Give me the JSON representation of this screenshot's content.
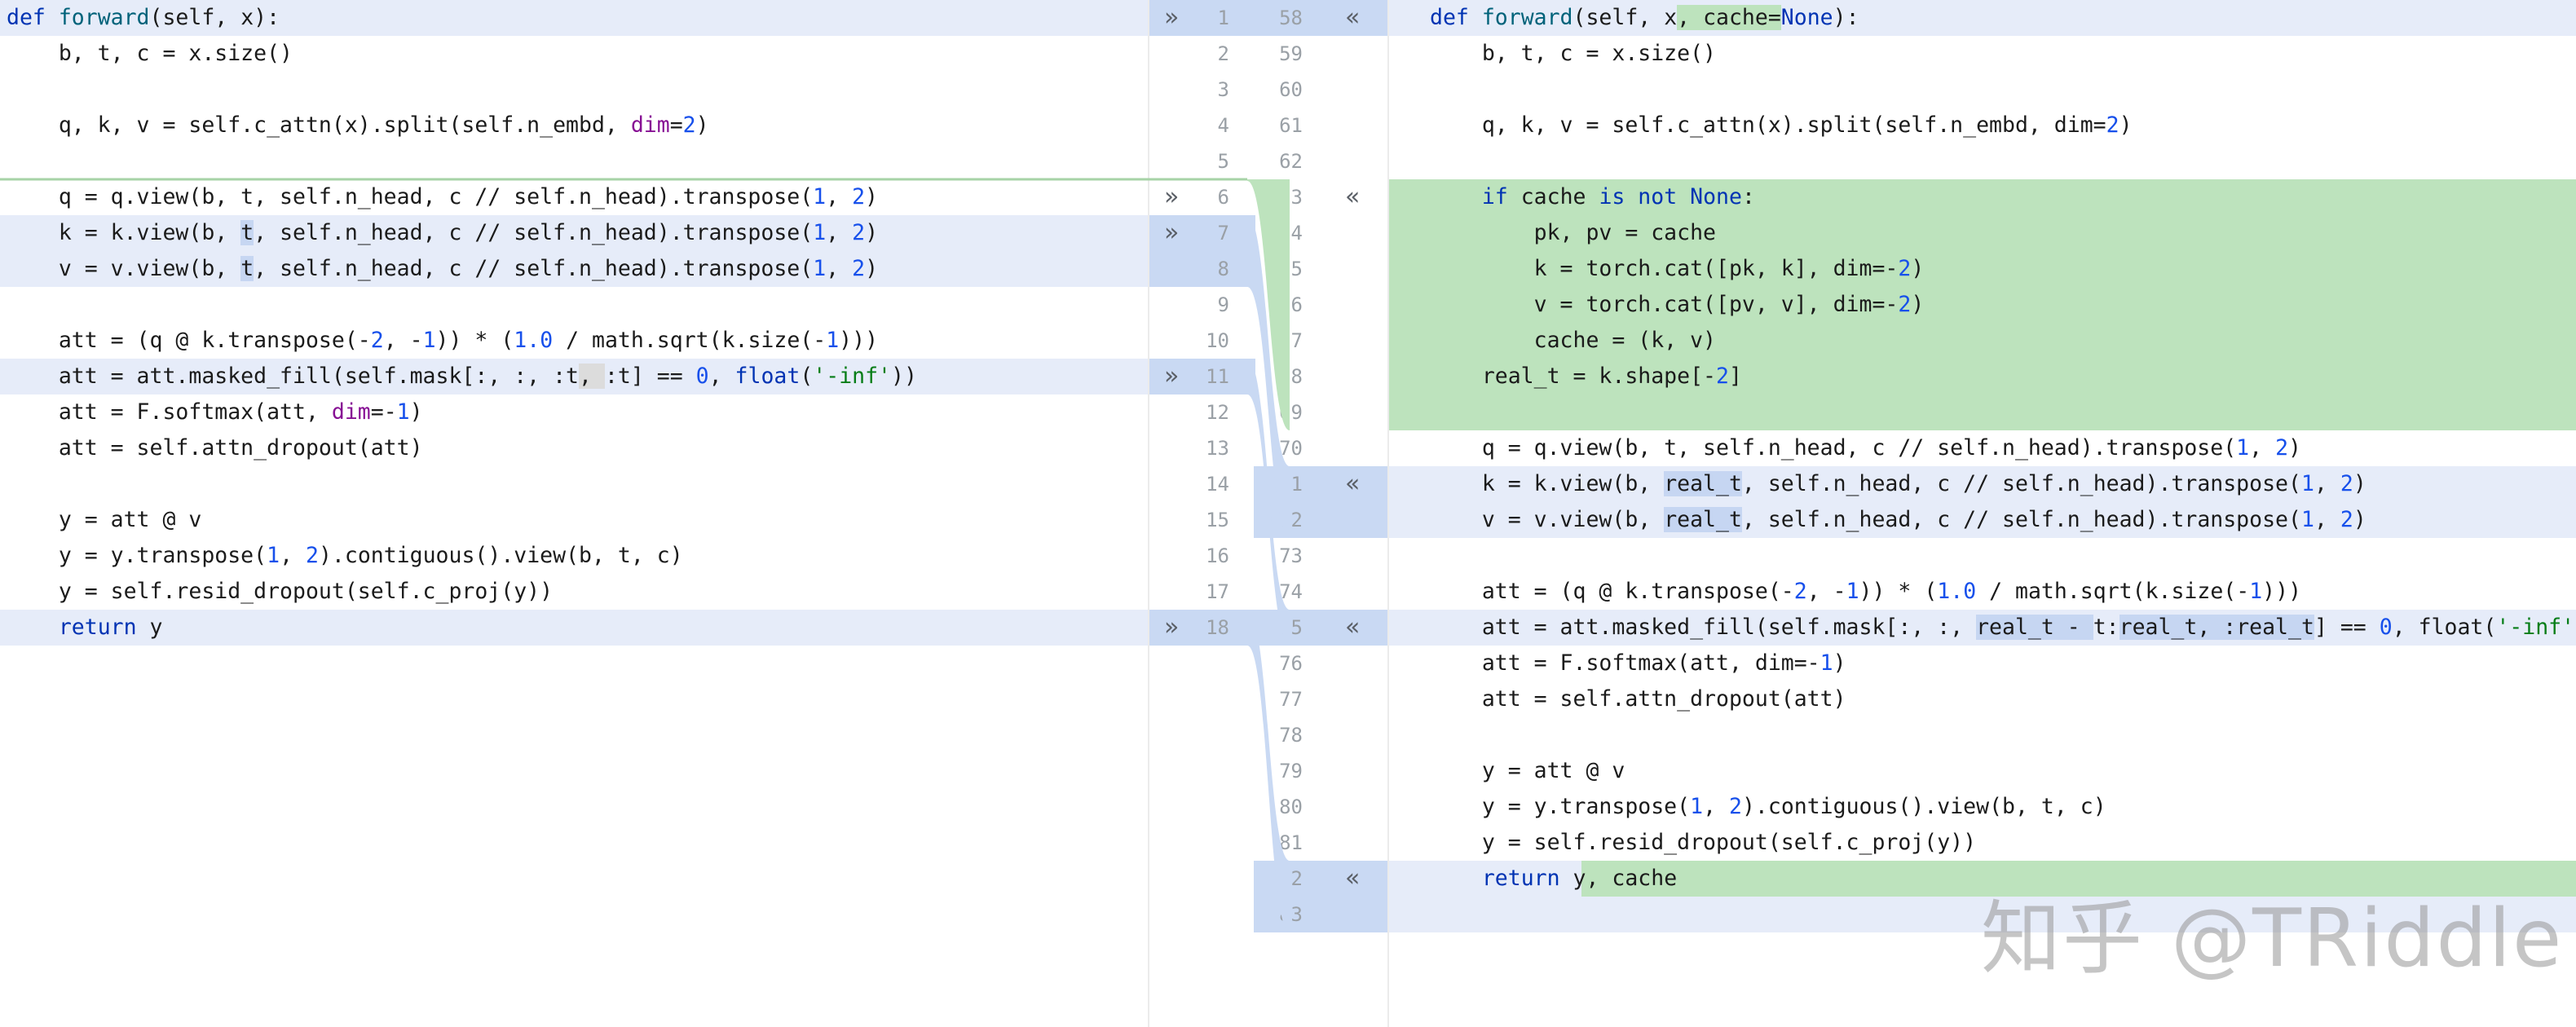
{
  "diff": {
    "left": [
      {
        "ln": "1",
        "state": "mod",
        "arrow": true,
        "parts": [
          [
            "def ",
            "kw"
          ],
          [
            "forward",
            "fn"
          ],
          [
            "(self, ",
            ""
          ],
          [
            "x",
            ""
          ],
          [
            "):",
            ""
          ]
        ]
      },
      {
        "ln": "2",
        "state": "",
        "parts": [
          [
            "    b, t, c = x.size()",
            ""
          ]
        ]
      },
      {
        "ln": "3",
        "state": "",
        "parts": [
          [
            "",
            ""
          ]
        ]
      },
      {
        "ln": "4",
        "state": "",
        "parts": [
          [
            "    q, k, v = self.c_attn(x).split(self.n_embd, ",
            ""
          ],
          [
            "dim",
            "param"
          ],
          [
            "=",
            ""
          ],
          [
            "2",
            "num"
          ],
          [
            ")",
            ""
          ]
        ]
      },
      {
        "ln": "5",
        "state": "",
        "parts": [
          [
            "",
            ""
          ]
        ]
      },
      {
        "ln": "6",
        "state": "",
        "arrow": true,
        "parts": [
          [
            "    q = q.view(b, t, self.n_head, c // self.n_head).transpose(",
            ""
          ],
          [
            "1",
            "num"
          ],
          [
            ", ",
            ""
          ],
          [
            "2",
            "num"
          ],
          [
            ")",
            ""
          ]
        ]
      },
      {
        "ln": "7",
        "state": "mod",
        "arrow": true,
        "parts": [
          [
            "    k = k.view(b, ",
            ""
          ],
          [
            "t",
            "hl"
          ],
          [
            ", self.n_head, c // self.n_head).transpose(",
            ""
          ],
          [
            "1",
            "num"
          ],
          [
            ", ",
            ""
          ],
          [
            "2",
            "num"
          ],
          [
            ")",
            ""
          ]
        ]
      },
      {
        "ln": "8",
        "state": "mod",
        "parts": [
          [
            "    v = v.view(b, ",
            ""
          ],
          [
            "t",
            "hl"
          ],
          [
            ", self.n_head, c // self.n_head).transpose(",
            ""
          ],
          [
            "1",
            "num"
          ],
          [
            ", ",
            ""
          ],
          [
            "2",
            "num"
          ],
          [
            ")",
            ""
          ]
        ]
      },
      {
        "ln": "9",
        "state": "",
        "parts": [
          [
            "",
            ""
          ]
        ]
      },
      {
        "ln": "10",
        "state": "",
        "parts": [
          [
            "    att = (q @ k.transpose(-",
            ""
          ],
          [
            "2",
            "num"
          ],
          [
            ", -",
            ""
          ],
          [
            "1",
            "num"
          ],
          [
            ")) * (",
            ""
          ],
          [
            "1.0",
            "num"
          ],
          [
            " / math.sqrt(k.size(-",
            ""
          ],
          [
            "1",
            "num"
          ],
          [
            ")))",
            ""
          ]
        ]
      },
      {
        "ln": "11",
        "state": "mod",
        "arrow": true,
        "parts": [
          [
            "    att = att.masked_fill(self.mask[:, :, ",
            ""
          ],
          [
            ":t",
            ""
          ],
          [
            ", ",
            "hl-gray"
          ],
          [
            ":t",
            ""
          ],
          [
            "] == ",
            ""
          ],
          [
            "0",
            "num"
          ],
          [
            ", ",
            ""
          ],
          [
            "float",
            "kw"
          ],
          [
            "(",
            ""
          ],
          [
            "'-inf'",
            "str"
          ],
          [
            "))",
            ""
          ]
        ]
      },
      {
        "ln": "12",
        "state": "",
        "parts": [
          [
            "    att = F.softmax(att, ",
            ""
          ],
          [
            "dim",
            "param"
          ],
          [
            "=-",
            ""
          ],
          [
            "1",
            "num"
          ],
          [
            ")",
            ""
          ]
        ]
      },
      {
        "ln": "13",
        "state": "",
        "parts": [
          [
            "    att = self.attn_dropout(att)",
            ""
          ]
        ]
      },
      {
        "ln": "14",
        "state": "",
        "parts": [
          [
            "",
            ""
          ]
        ]
      },
      {
        "ln": "15",
        "state": "",
        "parts": [
          [
            "    y = att @ v",
            ""
          ]
        ]
      },
      {
        "ln": "16",
        "state": "",
        "parts": [
          [
            "    y = y.transpose(",
            ""
          ],
          [
            "1",
            "num"
          ],
          [
            ", ",
            ""
          ],
          [
            "2",
            "num"
          ],
          [
            ").contiguous().view(b, t, c)",
            ""
          ]
        ]
      },
      {
        "ln": "17",
        "state": "",
        "parts": [
          [
            "    y = self.resid_dropout(self.c_proj(y))",
            ""
          ]
        ]
      },
      {
        "ln": "18",
        "state": "mod",
        "arrow": true,
        "parts": [
          [
            "    ",
            ""
          ],
          [
            "return",
            "kw"
          ],
          [
            " y",
            ""
          ]
        ]
      }
    ],
    "right": [
      {
        "ln": "58",
        "state": "mod",
        "arrow": true,
        "parts": [
          [
            "def ",
            "kw"
          ],
          [
            "forward",
            "fn"
          ],
          [
            "(self, x",
            ""
          ],
          [
            ", cache=",
            "hl-g"
          ],
          [
            "None",
            "kw"
          ],
          [
            "):",
            ""
          ]
        ]
      },
      {
        "ln": "59",
        "state": "",
        "parts": [
          [
            "    b, t, c = x.size()",
            ""
          ]
        ]
      },
      {
        "ln": "60",
        "state": "",
        "parts": [
          [
            "",
            ""
          ]
        ]
      },
      {
        "ln": "61",
        "state": "",
        "parts": [
          [
            "    q, k, v = self.c_attn(x).split(self.n_embd, dim=",
            ""
          ],
          [
            "2",
            "num"
          ],
          [
            ")",
            ""
          ]
        ]
      },
      {
        "ln": "62",
        "state": "",
        "parts": [
          [
            "",
            ""
          ]
        ]
      },
      {
        "ln": "63",
        "state": "add",
        "arrow": true,
        "parts": [
          [
            "    ",
            ""
          ],
          [
            "if",
            "kw"
          ],
          [
            " cache ",
            ""
          ],
          [
            "is not None",
            "kw"
          ],
          [
            ":",
            ""
          ]
        ]
      },
      {
        "ln": "64",
        "state": "add",
        "parts": [
          [
            "        pk, pv = cache",
            ""
          ]
        ]
      },
      {
        "ln": "65",
        "state": "add",
        "parts": [
          [
            "        k = torch.cat([pk, k], dim=-",
            ""
          ],
          [
            "2",
            "num"
          ],
          [
            ")",
            ""
          ]
        ]
      },
      {
        "ln": "66",
        "state": "add",
        "parts": [
          [
            "        v = torch.cat([pv, v], dim=-",
            ""
          ],
          [
            "2",
            "num"
          ],
          [
            ")",
            ""
          ]
        ]
      },
      {
        "ln": "67",
        "state": "add",
        "parts": [
          [
            "        cache = (k, v)",
            ""
          ]
        ]
      },
      {
        "ln": "68",
        "state": "add",
        "parts": [
          [
            "    real_t = k.shape[-",
            ""
          ],
          [
            "2",
            "num"
          ],
          [
            "]",
            ""
          ]
        ]
      },
      {
        "ln": "69",
        "state": "add",
        "parts": [
          [
            "",
            ""
          ]
        ]
      },
      {
        "ln": "70",
        "state": "",
        "parts": [
          [
            "    q = q.view(b, t, self.n_head, c // self.n_head).transpose(",
            ""
          ],
          [
            "1",
            "num"
          ],
          [
            ", ",
            ""
          ],
          [
            "2",
            "num"
          ],
          [
            ")",
            ""
          ]
        ]
      },
      {
        "ln": "71",
        "state": "mod",
        "arrow": true,
        "parts": [
          [
            "    k = k.view(b, ",
            ""
          ],
          [
            "real_t",
            "hl"
          ],
          [
            ", self.n_head, c // self.n_head).transpose(",
            ""
          ],
          [
            "1",
            "num"
          ],
          [
            ", ",
            ""
          ],
          [
            "2",
            "num"
          ],
          [
            ")",
            ""
          ]
        ]
      },
      {
        "ln": "72",
        "state": "mod",
        "parts": [
          [
            "    v = v.view(b, ",
            ""
          ],
          [
            "real_t",
            "hl"
          ],
          [
            ", self.n_head, c // self.n_head).transpose(",
            ""
          ],
          [
            "1",
            "num"
          ],
          [
            ", ",
            ""
          ],
          [
            "2",
            "num"
          ],
          [
            ")",
            ""
          ]
        ]
      },
      {
        "ln": "73",
        "state": "",
        "parts": [
          [
            "",
            ""
          ]
        ]
      },
      {
        "ln": "74",
        "state": "",
        "parts": [
          [
            "    att = (q @ k.transpose(-",
            ""
          ],
          [
            "2",
            "num"
          ],
          [
            ", -",
            ""
          ],
          [
            "1",
            "num"
          ],
          [
            ")) * (",
            ""
          ],
          [
            "1.0",
            "num"
          ],
          [
            " / math.sqrt(k.size(-",
            ""
          ],
          [
            "1",
            "num"
          ],
          [
            ")))",
            ""
          ]
        ]
      },
      {
        "ln": "75",
        "state": "mod",
        "arrow": true,
        "parts": [
          [
            "    att = att.masked_fill(self.mask[:, :, ",
            ""
          ],
          [
            "real_t - ",
            "hl"
          ],
          [
            "t:",
            ""
          ],
          [
            "real_t, :real_t",
            "hl"
          ],
          [
            "] == ",
            ""
          ],
          [
            "0",
            "num"
          ],
          [
            ", float(",
            ""
          ],
          [
            "'-inf'",
            "str"
          ],
          [
            "))",
            ""
          ]
        ]
      },
      {
        "ln": "76",
        "state": "",
        "parts": [
          [
            "    att = F.softmax(att, dim=-",
            ""
          ],
          [
            "1",
            "num"
          ],
          [
            ")",
            ""
          ]
        ]
      },
      {
        "ln": "77",
        "state": "",
        "parts": [
          [
            "    att = self.attn_dropout(att)",
            ""
          ]
        ]
      },
      {
        "ln": "78",
        "state": "",
        "parts": [
          [
            "",
            ""
          ]
        ]
      },
      {
        "ln": "79",
        "state": "",
        "parts": [
          [
            "    y = att @ v",
            ""
          ]
        ]
      },
      {
        "ln": "80",
        "state": "",
        "parts": [
          [
            "    y = y.transpose(",
            ""
          ],
          [
            "1",
            "num"
          ],
          [
            ", ",
            ""
          ],
          [
            "2",
            "num"
          ],
          [
            ").contiguous().view(b, t, c)",
            ""
          ]
        ]
      },
      {
        "ln": "81",
        "state": "",
        "parts": [
          [
            "    y = self.resid_dropout(self.c_proj(y))",
            ""
          ]
        ]
      },
      {
        "ln": "82",
        "state": "mod-tail",
        "arrow": true,
        "parts": [
          [
            "    ",
            ""
          ],
          [
            "return",
            "kw"
          ],
          [
            " y",
            ""
          ],
          [
            ", cache",
            "hl-g"
          ]
        ]
      },
      {
        "ln": "83",
        "state": "mod",
        "parts": [
          [
            "",
            ""
          ]
        ]
      }
    ]
  },
  "icons": {
    "apply": "double-chevron-right-icon",
    "revert": "double-chevron-left-icon"
  },
  "colors": {
    "modified": "#e6ecf9",
    "added": "#bde3bd",
    "inline_changed": "#c6d6f2"
  },
  "watermark": "知乎 @TRiddle"
}
